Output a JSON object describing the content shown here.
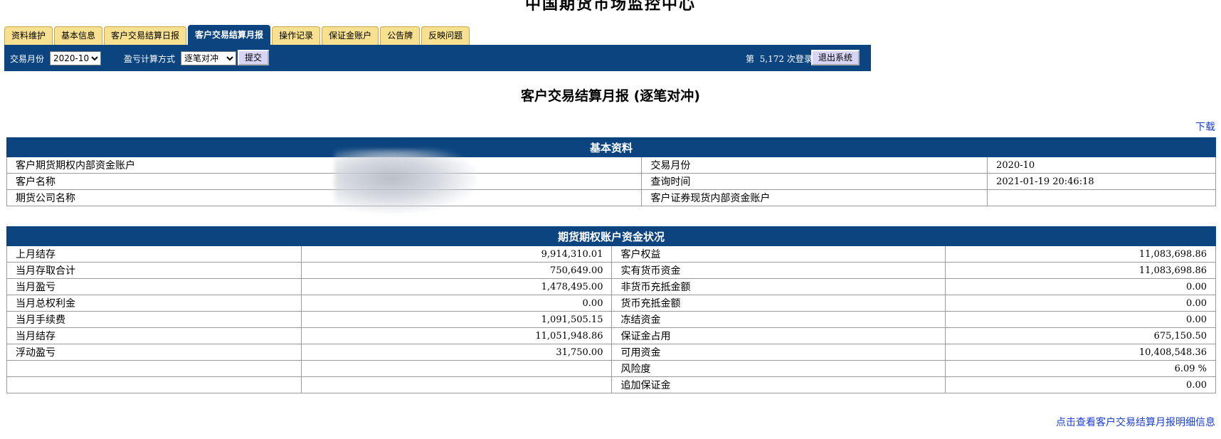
{
  "site_title": "中国期货市场监控中心",
  "tabs": [
    {
      "label": "资料维护"
    },
    {
      "label": "基本信息"
    },
    {
      "label": "客户交易结算日报"
    },
    {
      "label": "客户交易结算月报",
      "active": true
    },
    {
      "label": "操作记录"
    },
    {
      "label": "保证金账户"
    },
    {
      "label": "公告牌"
    },
    {
      "label": "反映问题"
    }
  ],
  "toolbar": {
    "month_label": "交易月份",
    "month_value": "2020-10",
    "calc_label": "盈亏计算方式",
    "calc_value": "逐笔对冲",
    "submit_label": "提交",
    "login_prefix": "第",
    "login_count": "5,172",
    "login_suffix": "次登录",
    "logout_label": "退出系统"
  },
  "page_heading": "客户交易结算月报 (逐笔对冲)",
  "download_label": "下载",
  "basic": {
    "header": "基本资料",
    "rows": [
      {
        "label1": "客户期货期权内部资金账户",
        "value1": "",
        "label2": "交易月份",
        "value2": "2020-10"
      },
      {
        "label1": "客户名称",
        "value1": "",
        "label2": "查询时间",
        "value2": "2021-01-19 20:46:18"
      },
      {
        "label1": "期货公司名称",
        "value1": "",
        "label2": "客户证券现货内部资金账户",
        "value2": ""
      }
    ]
  },
  "funds": {
    "header": "期货期权账户资金状况",
    "rows": [
      {
        "label1": "上月结存",
        "value1": "9,914,310.01",
        "label2": "客户权益",
        "value2": "11,083,698.86"
      },
      {
        "label1": "当月存取合计",
        "value1": "750,649.00",
        "label2": "实有货币资金",
        "value2": "11,083,698.86"
      },
      {
        "label1": "当月盈亏",
        "value1": "1,478,495.00",
        "label2": "非货币充抵金额",
        "value2": "0.00"
      },
      {
        "label1": "当月总权利金",
        "value1": "0.00",
        "label2": "货币充抵金额",
        "value2": "0.00"
      },
      {
        "label1": "当月手续费",
        "value1": "1,091,505.15",
        "label2": "冻结资金",
        "value2": "0.00"
      },
      {
        "label1": "当月结存",
        "value1": "11,051,948.86",
        "label2": "保证金占用",
        "value2": "675,150.50"
      },
      {
        "label1": "浮动盈亏",
        "value1": "31,750.00",
        "label2": "可用资金",
        "value2": "10,408,548.36"
      },
      {
        "label1": "",
        "value1": "",
        "label2": "风险度",
        "value2": "6.09 %"
      },
      {
        "label1": "",
        "value1": "",
        "label2": "追加保证金",
        "value2": "0.00"
      }
    ]
  },
  "detail_link": "点击查看客户交易结算月报明细信息"
}
